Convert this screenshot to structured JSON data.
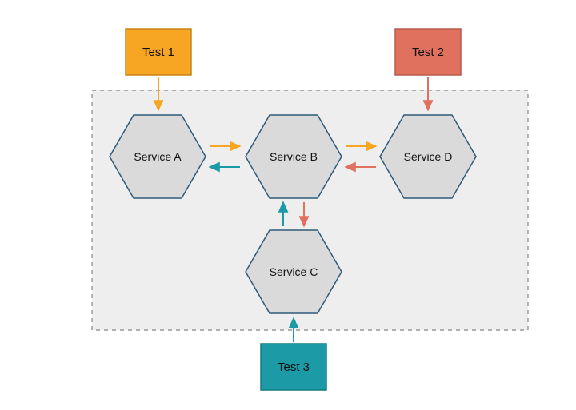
{
  "tests": {
    "t1": {
      "label": "Test 1",
      "fill": "#F6A623",
      "stroke": "#C8821A"
    },
    "t2": {
      "label": "Test 2",
      "fill": "#E1715F",
      "stroke": "#B75A4C"
    },
    "t3": {
      "label": "Test 3",
      "fill": "#1C9BA6",
      "stroke": "#167982"
    }
  },
  "services": {
    "a": {
      "label": "Service A"
    },
    "b": {
      "label": "Service B"
    },
    "c": {
      "label": "Service C"
    },
    "d": {
      "label": "Service D"
    }
  },
  "container": {
    "fill": "#EEEEEE",
    "stroke": "#888"
  },
  "hex": {
    "fill": "#DADADA",
    "stroke": "#2F5A78"
  },
  "arrows": {
    "orange": "#F6A623",
    "teal": "#1C9BA6",
    "coral": "#E1715F"
  }
}
